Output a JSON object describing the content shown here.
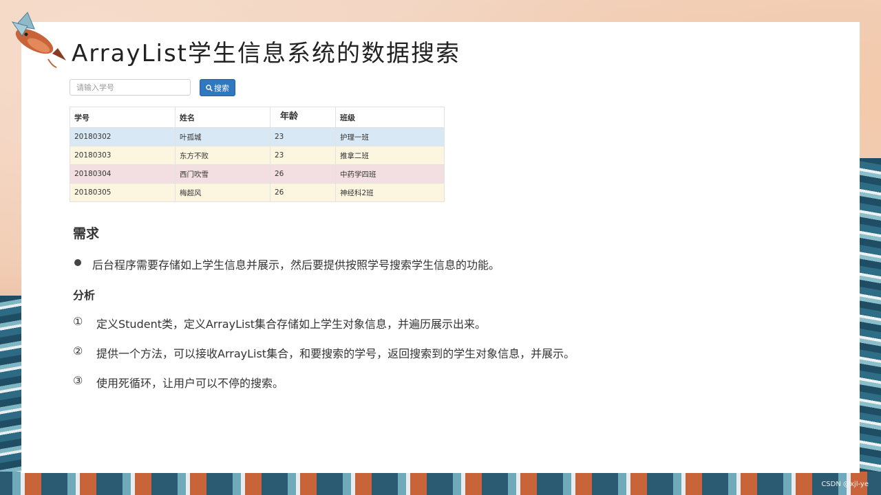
{
  "title": "ArrayList学生信息系统的数据搜索",
  "search": {
    "placeholder": "请输入学号",
    "button_label": "搜索"
  },
  "table": {
    "headers": [
      "学号",
      "姓名",
      "年龄",
      "班级"
    ],
    "rows": [
      [
        "20180302",
        "叶孤城",
        "23",
        "护理一班"
      ],
      [
        "20180303",
        "东方不败",
        "23",
        "推拿二班"
      ],
      [
        "20180304",
        "西门吹雪",
        "26",
        "中药学四班"
      ],
      [
        "20180305",
        "梅超风",
        "26",
        "神经科2班"
      ]
    ]
  },
  "requirements": {
    "heading": "需求",
    "bullet": "后台程序需要存储如上学生信息并展示，然后要提供按照学号搜索学生信息的功能。"
  },
  "analysis": {
    "heading": "分析",
    "steps": [
      {
        "num": "①",
        "text": "定义Student类，定义ArrayList集合存储如上学生对象信息，并遍历展示出来。"
      },
      {
        "num": "②",
        "text": "提供一个方法，可以接收ArrayList集合，和要搜索的学号，返回搜索到的学生对象信息，并展示。"
      },
      {
        "num": "③",
        "text": "使用死循环，让用户可以不停的搜索。"
      }
    ]
  },
  "watermark": "CSDN @xjl-ye",
  "colors": {
    "button": "#2f78c0",
    "row_blue": "#d9e8f5",
    "row_yellow": "#fcf6e1",
    "row_pink": "#f3dfe1"
  }
}
